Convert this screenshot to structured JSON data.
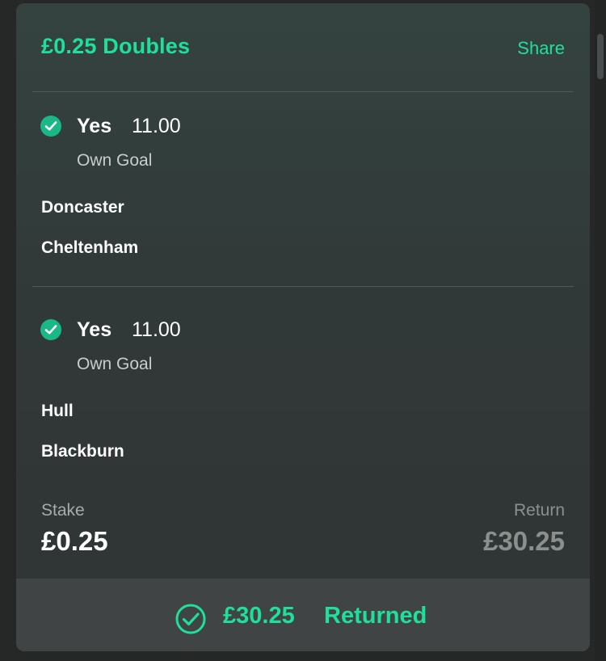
{
  "bet": {
    "title": "£0.25 Doubles",
    "share_label": "Share"
  },
  "legs": [
    {
      "selection": "Yes",
      "odds": "11.00",
      "market": "Own Goal",
      "home_team": "Doncaster",
      "away_team": "Cheltenham",
      "status_icon": "check-circle-icon"
    },
    {
      "selection": "Yes",
      "odds": "11.00",
      "market": "Own Goal",
      "home_team": "Hull",
      "away_team": "Blackburn",
      "status_icon": "check-circle-icon"
    }
  ],
  "summary": {
    "stake_label": "Stake",
    "stake_value": "£0.25",
    "return_label": "Return",
    "return_value": "£30.25"
  },
  "footer": {
    "amount": "£30.25",
    "status": "Returned",
    "icon": "check-circle-outline-icon"
  },
  "colors": {
    "accent": "#1ee09a",
    "check_fill": "#1ab787",
    "card_bg": "#313938",
    "footer_bg": "#414444",
    "muted_text": "#8b8f8e"
  }
}
